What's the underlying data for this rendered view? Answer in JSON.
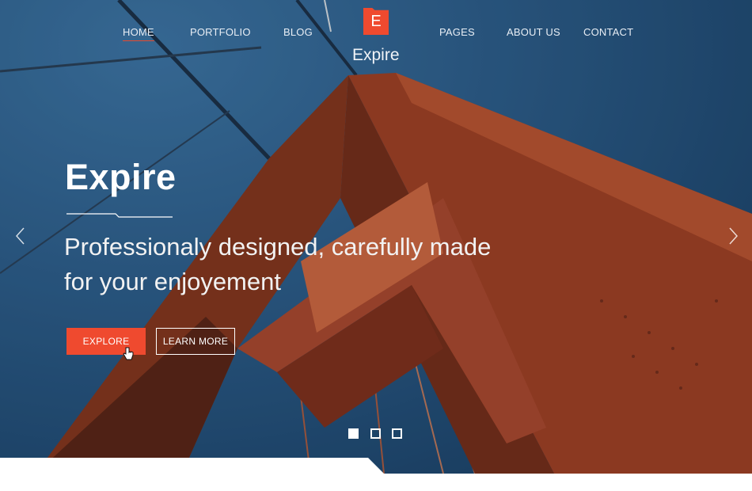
{
  "nav": {
    "items": [
      {
        "label": "HOME",
        "active": true
      },
      {
        "label": "PORTFOLIO"
      },
      {
        "label": "BLOG"
      },
      {
        "label": "PAGES"
      },
      {
        "label": "ABOUT US"
      },
      {
        "label": "CONTACT"
      }
    ]
  },
  "brand": {
    "mark": "E",
    "name": "Expire"
  },
  "hero": {
    "title": "Expire",
    "subtitle_line1": "Professionaly designed, carefully made",
    "subtitle_line2": "for your enjoyement",
    "explore_label": "EXPLORE",
    "learn_more_label": "LEARN MORE"
  },
  "slider": {
    "prev_icon": "chevron-left-icon",
    "next_icon": "chevron-right-icon",
    "slide_count": 3,
    "active_slide": 1
  },
  "colors": {
    "accent": "#ef4a2f",
    "sky": "#2e5f8c",
    "bridge": "#a33f1f"
  }
}
